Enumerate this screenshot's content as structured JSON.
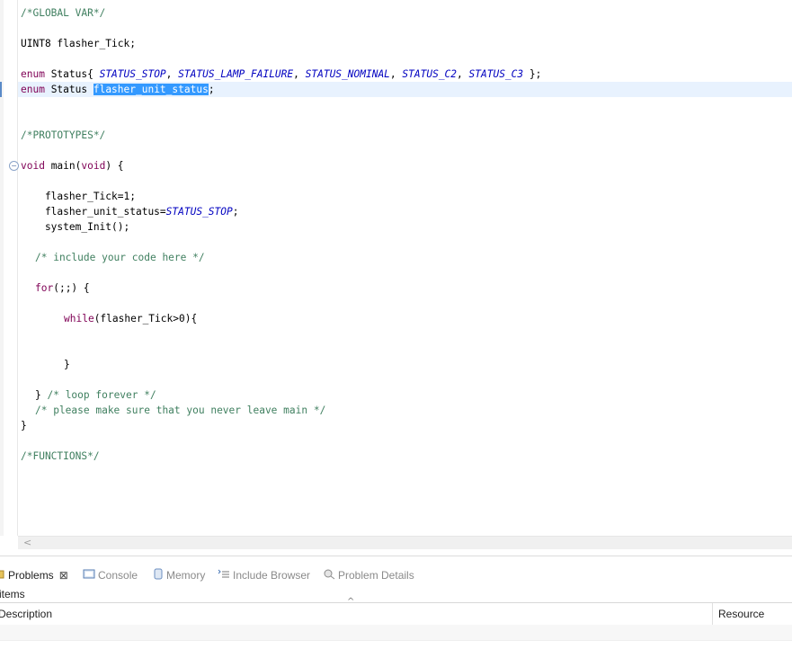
{
  "editor": {
    "lines": {
      "global_var": "/*GLOBAL VAR*/",
      "uint8_decl": "UINT8 flasher_Tick;",
      "enum_kw1": "enum",
      "enum_decl_pre": " Status{ ",
      "e_stop": "STATUS_STOP",
      "e_lamp": "STATUS_LAMP_FAILURE",
      "e_nominal": "STATUS_NOMINAL",
      "e_c2": "STATUS_C2",
      "e_c3": "STATUS_C3",
      "enum_decl_end": " };",
      "enum_kw2": "enum",
      "enum_var_pre": " Status ",
      "enum_var_sel": "flasher_unit_status",
      "enum_var_end": ";",
      "prototypes": "/*PROTOTYPES*/",
      "void_kw": "void",
      "main_sig_mid": " main(",
      "void_kw2": "void",
      "main_sig_end": ") {",
      "tick_assign": "    flasher_Tick=1;",
      "status_assign_pre": "    flasher_unit_status=",
      "status_assign_end": ";",
      "sys_init": "    system_Init();",
      "include_comment": "/* include your code here */",
      "for_kw": "for",
      "for_rest": "(;;) {",
      "while_kw": "while",
      "while_rest": "(flasher_Tick>0){",
      "while_close": "}",
      "loop_close": "} ",
      "loop_comment": "/* loop forever */",
      "leave_comment": "/* please make sure that you never leave main */",
      "main_close": "}",
      "functions": "/*FUNCTIONS*/"
    }
  },
  "panel": {
    "tabs": [
      {
        "label": "Problems",
        "icon": "problems-icon",
        "active": true
      },
      {
        "label": "Console",
        "icon": "console-icon"
      },
      {
        "label": "Memory",
        "icon": "memory-icon"
      },
      {
        "label": "Include Browser",
        "icon": "include-browser-icon"
      },
      {
        "label": "Problem Details",
        "icon": "problem-details-icon"
      }
    ],
    "items_text": "items",
    "columns": {
      "description": "Description",
      "resource": "Resource"
    }
  },
  "colors": {
    "keyword": "#7f0055",
    "comment": "#3f7f5f",
    "enum_constant": "#0000c0",
    "selection": "#3399ff",
    "current_line": "#e8f2fe"
  }
}
